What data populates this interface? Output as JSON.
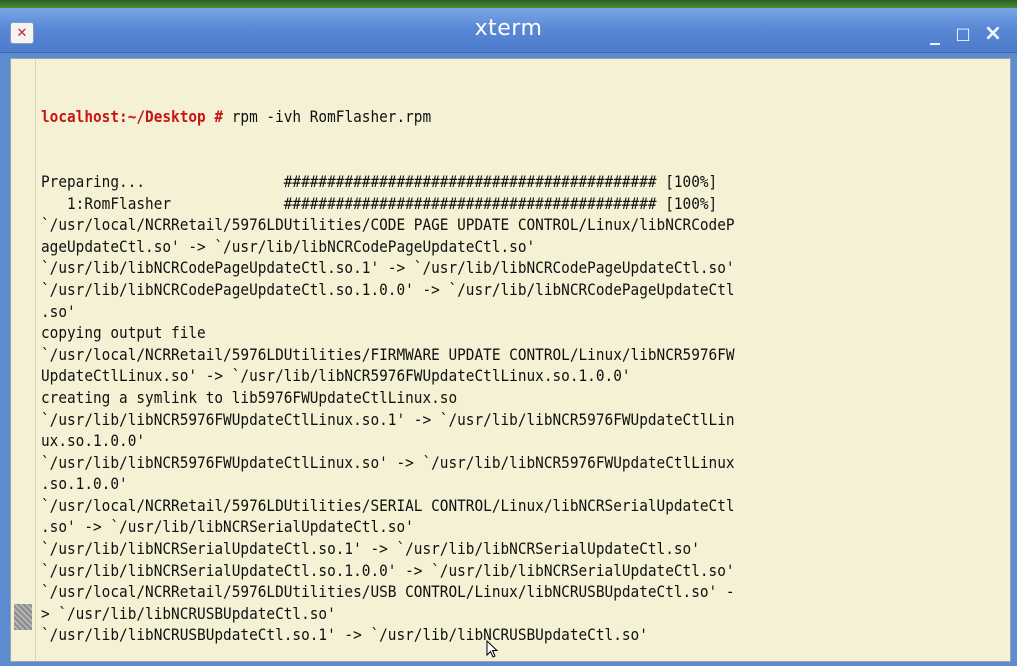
{
  "window": {
    "title": "xterm",
    "menu_icon": "close-x-icon",
    "controls": {
      "minimize": "_",
      "maximize": "□",
      "close": "×"
    }
  },
  "terminal": {
    "prompt": "localhost:~/Desktop #",
    "command": " rpm -ivh RomFlasher.rpm",
    "lines": [
      "Preparing...                ########################################### [100%]",
      "   1:RomFlasher             ########################################### [100%]",
      "`/usr/local/NCRRetail/5976LDUtilities/CODE PAGE UPDATE CONTROL/Linux/libNCRCodeP",
      "ageUpdateCtl.so' -> `/usr/lib/libNCRCodePageUpdateCtl.so'",
      "`/usr/lib/libNCRCodePageUpdateCtl.so.1' -> `/usr/lib/libNCRCodePageUpdateCtl.so'",
      "`/usr/lib/libNCRCodePageUpdateCtl.so.1.0.0' -> `/usr/lib/libNCRCodePageUpdateCtl",
      ".so'",
      "copying output file",
      "`/usr/local/NCRRetail/5976LDUtilities/FIRMWARE UPDATE CONTROL/Linux/libNCR5976FW",
      "UpdateCtlLinux.so' -> `/usr/lib/libNCR5976FWUpdateCtlLinux.so.1.0.0'",
      "creating a symlink to lib5976FWUpdateCtlLinux.so",
      "`/usr/lib/libNCR5976FWUpdateCtlLinux.so.1' -> `/usr/lib/libNCR5976FWUpdateCtlLin",
      "ux.so.1.0.0'",
      "`/usr/lib/libNCR5976FWUpdateCtlLinux.so' -> `/usr/lib/libNCR5976FWUpdateCtlLinux",
      ".so.1.0.0'",
      "`/usr/local/NCRRetail/5976LDUtilities/SERIAL CONTROL/Linux/libNCRSerialUpdateCtl",
      ".so' -> `/usr/lib/libNCRSerialUpdateCtl.so'",
      "`/usr/lib/libNCRSerialUpdateCtl.so.1' -> `/usr/lib/libNCRSerialUpdateCtl.so'",
      "`/usr/lib/libNCRSerialUpdateCtl.so.1.0.0' -> `/usr/lib/libNCRSerialUpdateCtl.so'",
      "`/usr/local/NCRRetail/5976LDUtilities/USB CONTROL/Linux/libNCRUSBUpdateCtl.so' -",
      "> `/usr/lib/libNCRUSBUpdateCtl.so'",
      "`/usr/lib/libNCRUSBUpdateCtl.so.1' -> `/usr/lib/libNCRUSBUpdateCtl.so'"
    ]
  },
  "colors": {
    "title_bar": "#5a88d6",
    "terminal_bg": "#f4f1d4",
    "terminal_fg": "#101010",
    "prompt": "#c81414"
  }
}
